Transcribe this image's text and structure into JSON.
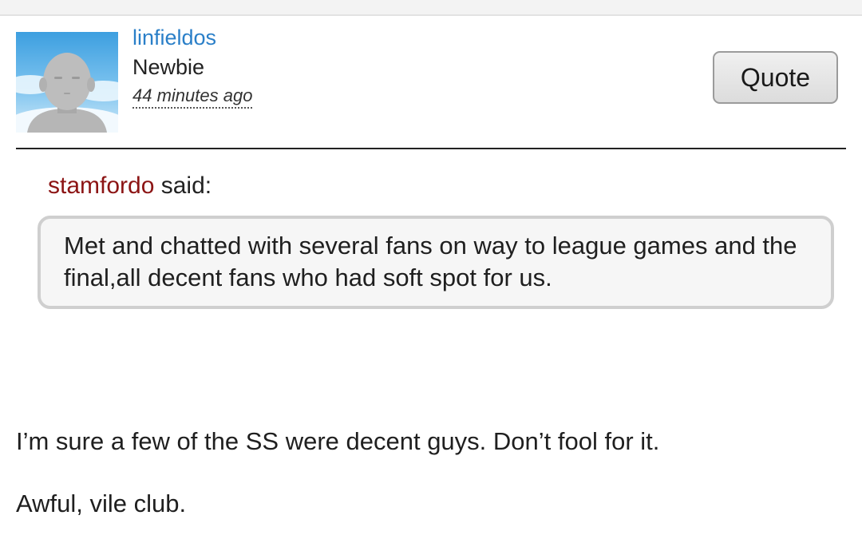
{
  "post": {
    "author": {
      "name": "linfieldos",
      "title": "Newbie",
      "time": "44 minutes ago",
      "avatar_icon": "default-avatar-icon"
    },
    "quote_button_label": "Quote",
    "quoted": {
      "author": "stamfordo",
      "said_suffix": " said:",
      "text": "Met and chatted with several fans on way to league games and the final,all decent fans who had soft spot for us."
    },
    "body": [
      "I’m sure a few of the SS were decent guys. Don’t fool for it.",
      "Awful, vile club."
    ]
  },
  "colors": {
    "username_link": "#2a7fc8",
    "quoted_author": "#8c1414",
    "avatar_sky": "#5fb3e8"
  }
}
